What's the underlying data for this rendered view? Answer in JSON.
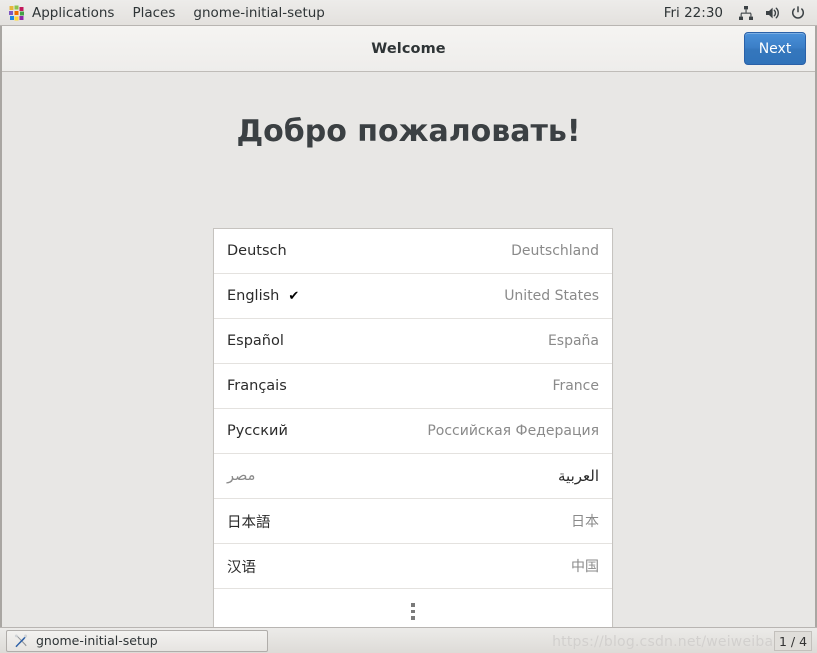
{
  "top_panel": {
    "applications_label": "Applications",
    "places_label": "Places",
    "window_menu_label": "gnome-initial-setup",
    "clock": "Fri 22:30",
    "icons": {
      "applications": "applications-grid-icon",
      "network": "network-icon",
      "volume": "volume-icon",
      "power": "power-icon"
    }
  },
  "window": {
    "title": "Welcome",
    "next_label": "Next",
    "heading": "Добро пожаловать!"
  },
  "language_list": {
    "rows": [
      {
        "name": "Deutsch",
        "region": "Deutschland",
        "selected": false,
        "rtl": false
      },
      {
        "name": "English",
        "region": "United States",
        "selected": true,
        "rtl": false
      },
      {
        "name": "Español",
        "region": "España",
        "selected": false,
        "rtl": false
      },
      {
        "name": "Français",
        "region": "France",
        "selected": false,
        "rtl": false
      },
      {
        "name": "Русский",
        "region": "Российская Федерация",
        "selected": false,
        "rtl": false
      },
      {
        "name": "العربية",
        "region": "مصر",
        "selected": false,
        "rtl": true
      },
      {
        "name": "日本語",
        "region": "日本",
        "selected": false,
        "rtl": false
      },
      {
        "name": "汉语",
        "region": "中国",
        "selected": false,
        "rtl": false
      }
    ],
    "check_glyph": "✔",
    "more_label": "more-options"
  },
  "taskbar": {
    "task_label": "gnome-initial-setup",
    "workspace": "1 / 4",
    "watermark": "https://blog.csdn.net/weiweibao"
  },
  "colors": {
    "accent": "#3b7ec6",
    "panel_bg": "#e8e7e5",
    "list_bg": "#ffffff",
    "heading": "#3b4043",
    "region_text": "#8a8a8a"
  }
}
